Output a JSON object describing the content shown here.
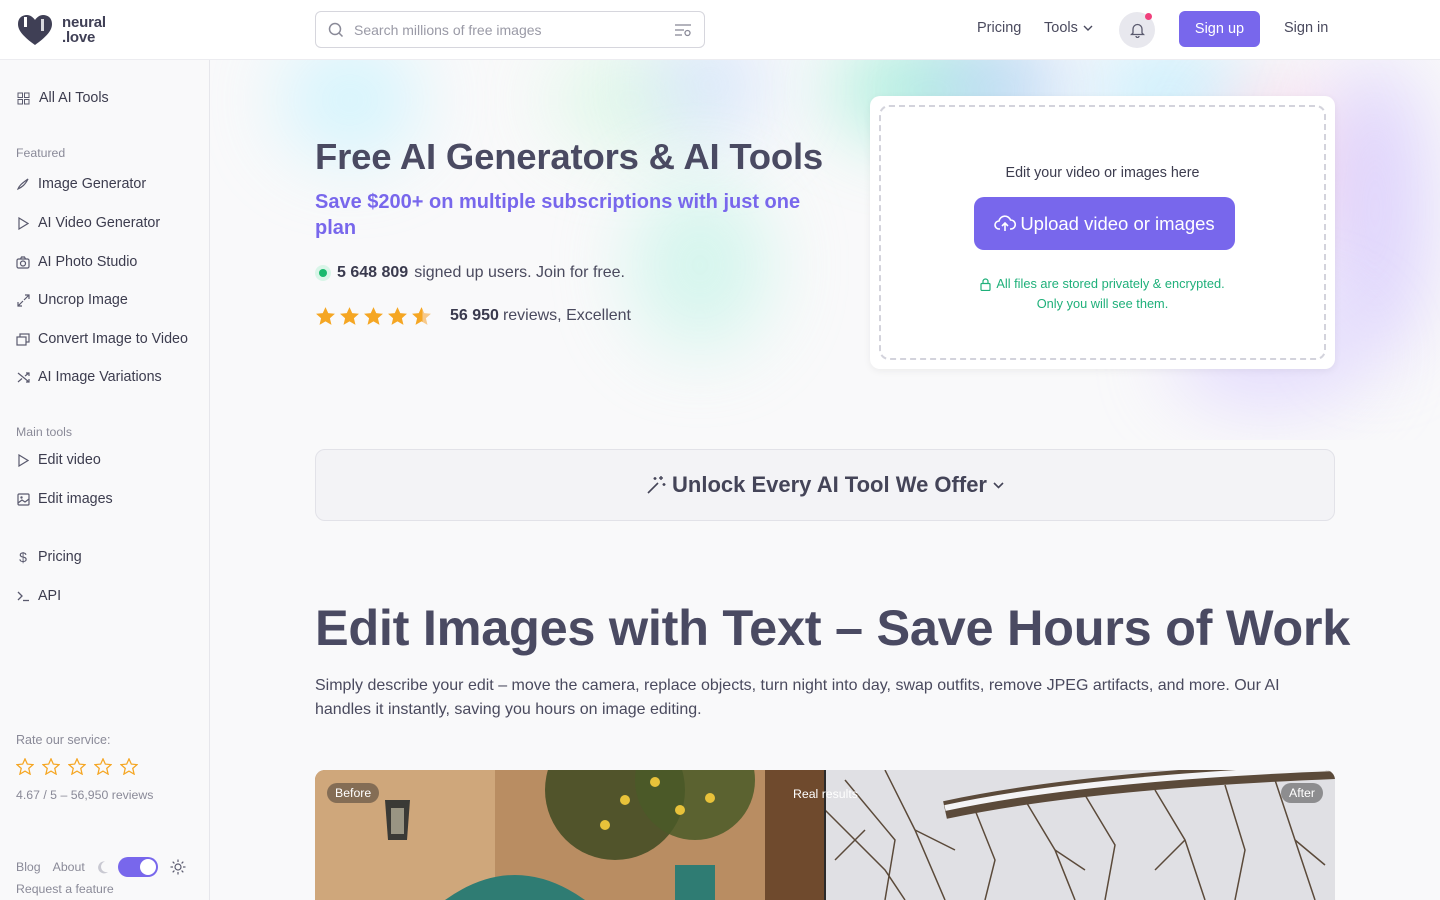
{
  "header": {
    "logo_line1": "neural",
    "logo_line2": ".love",
    "search_placeholder": "Search millions of free images",
    "nav": {
      "pricing": "Pricing",
      "tools": "Tools"
    },
    "signup": "Sign up",
    "signin": "Sign in"
  },
  "sidebar": {
    "all_tools": "All AI Tools",
    "featured_label": "Featured",
    "featured": [
      {
        "label": "Image Generator",
        "icon": "brush-icon"
      },
      {
        "label": "AI Video Generator",
        "icon": "play-icon"
      },
      {
        "label": "AI Photo Studio",
        "icon": "camera-icon"
      },
      {
        "label": "Uncrop Image",
        "icon": "expand-icon"
      },
      {
        "label": "Convert Image to Video",
        "icon": "image-to-video-icon"
      },
      {
        "label": "AI Image Variations",
        "icon": "shuffle-icon"
      }
    ],
    "main_label": "Main tools",
    "main": [
      {
        "label": "Edit video",
        "icon": "play-icon"
      },
      {
        "label": "Edit images",
        "icon": "image-icon"
      }
    ],
    "other": [
      {
        "label": "Pricing",
        "icon": "dollar-icon"
      },
      {
        "label": "API",
        "icon": "terminal-icon"
      }
    ],
    "rate_label": "Rate our service:",
    "rate_text": "4.67 / 5 – 56,950 reviews",
    "footer": {
      "blog": "Blog",
      "about": "About",
      "request": "Request a feature"
    }
  },
  "hero": {
    "title": "Free AI Generators & AI Tools",
    "subtitle": "Save $200+ on multiple subscriptions with just one plan",
    "users_count": "5 648 809",
    "users_text": "signed up users. Join for free.",
    "rating_stars": 4.5,
    "reviews_count": "56 950",
    "reviews_text": "reviews, Excellent"
  },
  "upload": {
    "title": "Edit your video or images here",
    "button": "Upload video or images",
    "privacy_line1": "All files are stored privately & encrypted.",
    "privacy_line2": "Only you will see them."
  },
  "unlock": {
    "label": "Unlock Every AI Tool We Offer"
  },
  "section": {
    "title": "Edit Images with Text – Save Hours of Work",
    "description": "Simply describe your edit – move the camera, replace objects, turn night into day, swap outfits, remove JPEG artifacts, and more. Our AI handles it instantly, saving you hours on image editing."
  },
  "compare": {
    "before": "Before",
    "real": "Real results",
    "after": "After"
  },
  "colors": {
    "accent": "#7867ec",
    "success": "#1fb07a",
    "star": "#f5a623"
  }
}
